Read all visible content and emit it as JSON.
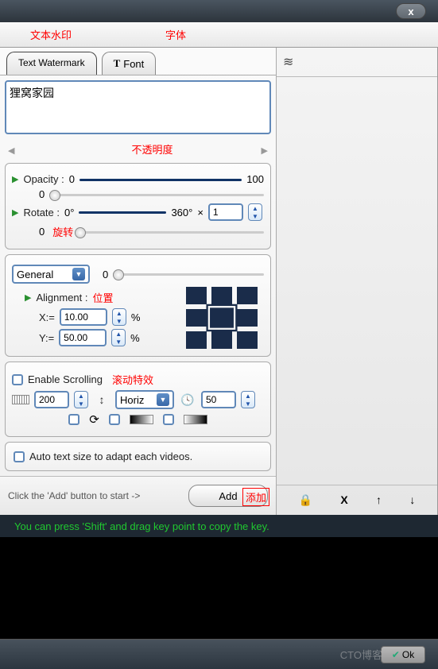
{
  "annotations": {
    "text_watermark": "文本水印",
    "font": "字体",
    "opacity": "不透明度",
    "rotate": "旋转",
    "position": "位置",
    "scrolling_effect": "滚动特效",
    "add": "添加"
  },
  "tabs": {
    "text_watermark": "Text Watermark",
    "font": "Font"
  },
  "text_input": "狸窝家园",
  "opacity": {
    "label": "Opacity :",
    "min": "0",
    "max": "100",
    "value": "0"
  },
  "rotate": {
    "label": "Rotate  :",
    "min": "0°",
    "max": "360°",
    "times": "×",
    "value": "1",
    "current": "0"
  },
  "general": {
    "dropdown": "General",
    "value": "0"
  },
  "alignment": {
    "label": "Alignment :",
    "x_label": "X:=",
    "x_value": "10.00",
    "y_label": "Y:=",
    "y_value": "50.00",
    "percent": "%"
  },
  "scrolling": {
    "enable_label": "Enable Scrolling",
    "width": "200",
    "direction": "Horiz",
    "speed": "50"
  },
  "auto_text": "Auto text size to adapt each videos.",
  "add_bar": {
    "hint": "Click the 'Add' button to start ->",
    "button": "Add"
  },
  "shift_hint": "You can press 'Shift' and drag key point to copy the key.",
  "footer": {
    "ok": "Ok",
    "watermark": "CTO博客"
  },
  "close": "x",
  "right_toolbar": {
    "lock": "🔒",
    "delete": "X",
    "up": "↑",
    "down": "↓"
  }
}
